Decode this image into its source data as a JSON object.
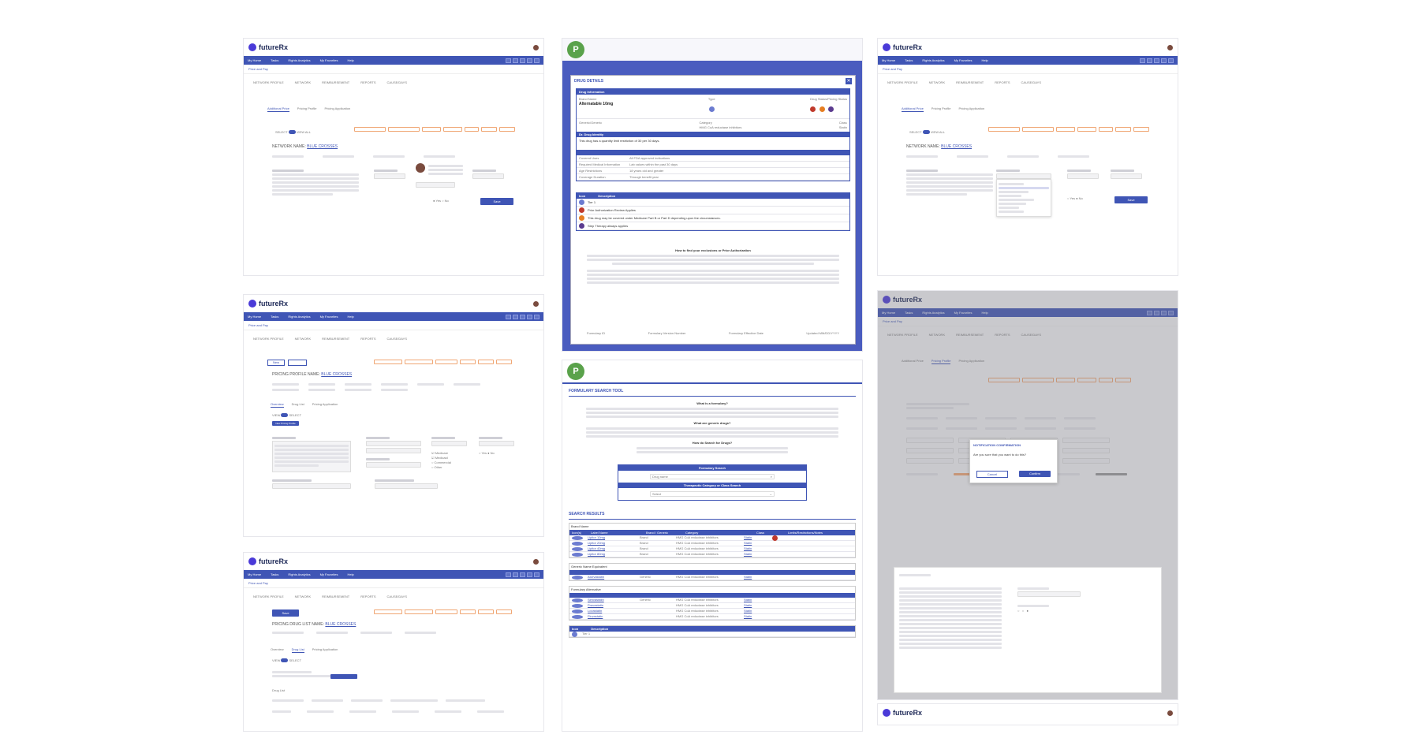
{
  "app": {
    "brand": "futureRx",
    "crumb": "Price and Pay",
    "nav_items": [
      "My Home",
      "Tasks",
      "Rights Analytics",
      "My Favorites",
      "Help"
    ]
  },
  "network": {
    "tabs": [
      "NETWORK PROFILE",
      "NETWORK",
      "REIMBURSEMENT",
      "REPORTS",
      "CAUSE/DAYS"
    ],
    "subtabs": [
      "Additional Price",
      "Pricing Profile",
      "Pricing Application"
    ],
    "name_label": "NETWORK NAME:",
    "name_value": "BLUE CROSSES",
    "save_label": "Save",
    "toggle_labels": [
      "SELECT",
      "VIEW ALL"
    ]
  },
  "pricing_profile": {
    "name_label": "PRICING PROFILE NAME:",
    "name_value": "BLUE CROSSES",
    "subtabs": [
      "Overview",
      "Drug List",
      "Pricing Application"
    ],
    "new_button": "New",
    "new_pricing_profile": "New Pricing Profile"
  },
  "drug_list": {
    "name_label": "PRICING DRUG LIST NAME:",
    "name_value": "BLUE CROSSES",
    "subtabs": [
      "Overview",
      "Drug List",
      "Pricing Application"
    ],
    "left_label": "Drug List",
    "button": "Save"
  },
  "drug_details": {
    "title": "DRUG DETAILS",
    "section_info": "Drug Information",
    "brand_label": "Brand Name",
    "brand_value": "Alternatable 10mg",
    "type_label": "Type",
    "status_label": "Drug Status/Pricing Status",
    "generic_label": "Generic/Generic",
    "category_label": "Category",
    "category_value": "HMG CoA reductase inhibitors",
    "class_label": "Class",
    "class_value": "Statin",
    "note_bar": "Dr. Drug Identity",
    "note_text": "This drug has a quantity limit restriction of 30 per 30 days.",
    "rows": [
      {
        "label": "Covered Uses",
        "value": "All FDA approved indications"
      },
      {
        "label": "Required Medical Information",
        "value": "Lab values within the past 30 days"
      },
      {
        "label": "Age Restrictions",
        "value": "18 years old and greater"
      },
      {
        "label": "Coverage Duration",
        "value": "Through benefit year"
      }
    ],
    "legend_head_a": "Icon",
    "legend_head_b": "Description",
    "legend": [
      "Tier 1",
      "Prior Authorization Review Applies",
      "This drug may be covered under Medicare Part B or Part D depending upon the circumstances.",
      "Step Therapy always applies"
    ],
    "footer_title": "How to find your exclusions or Prior Authorization",
    "footer_links": [
      "Formulary ID",
      "Formulary Version Number",
      "Formulary Effective Date",
      "Updated MM/DD/YYYY"
    ]
  },
  "formulary": {
    "title": "FORMULARY SEARCH TOOL",
    "what_is": "What is a formulary?",
    "what_drugs": "What are generic drugs?",
    "how_search": "How do Search for Drugs?",
    "search_head": "Formulary Search",
    "search_placeholder": "Drug name",
    "category_head": "Therapeutic Category or Class Search",
    "category_placeholder": "Select",
    "results_title": "SEARCH RESULTS",
    "brand_head": "Brand Name",
    "generic_head": "Generic Name Equivalent",
    "alt_head": "Formulary Alternative",
    "cols": [
      "Icon(s)",
      "Label Name",
      "Brand / Generic",
      "Category",
      "Class",
      "Limits/Restrictions/Notes"
    ],
    "brand_rows": [
      {
        "name": "Lipitor 10mg",
        "type": "Brand",
        "cat": "HMG CoA reductase inhibitors",
        "cls": "Statin"
      },
      {
        "name": "Lipitor 20mg",
        "type": "Brand",
        "cat": "HMG CoA reductase inhibitors",
        "cls": "Statin"
      },
      {
        "name": "Lipitor 40mg",
        "type": "Brand",
        "cat": "HMG CoA reductase inhibitors",
        "cls": "Statin"
      },
      {
        "name": "Lipitor 80mg",
        "type": "Brand",
        "cat": "HMG CoA reductase inhibitors",
        "cls": "Statin"
      }
    ],
    "generic_rows": [
      {
        "name": "Atorvastatin",
        "type": "Generic",
        "cat": "HMG CoA reductase inhibitors",
        "cls": "Statin"
      }
    ],
    "alt_rows": [
      {
        "name": "Simvastatin",
        "type": "Generic",
        "cat": "HMG CoA reductase inhibitors",
        "cls": "Statin"
      },
      {
        "name": "Pravastatin",
        "type": "",
        "cat": "HMG CoA reductase inhibitors",
        "cls": "Statin"
      },
      {
        "name": "Lovastatin",
        "type": "",
        "cat": "HMG CoA reductase inhibitors",
        "cls": "Statin"
      },
      {
        "name": "Fluvastatin",
        "type": "",
        "cat": "HMG CoA reductase inhibitors",
        "cls": "Statin"
      }
    ],
    "icon_head": "Icon",
    "desc_head": "Description",
    "tier": "Tier 1"
  },
  "confirm_modal": {
    "title": "NOTIFICATION CONFIRMATION",
    "message": "Are you sure that you want to do this?",
    "cancel": "Cancel",
    "confirm": "Confirm"
  },
  "colors": {
    "primary": "#3f55b5",
    "orange": "#f0a673",
    "green": "#5aa24b"
  }
}
